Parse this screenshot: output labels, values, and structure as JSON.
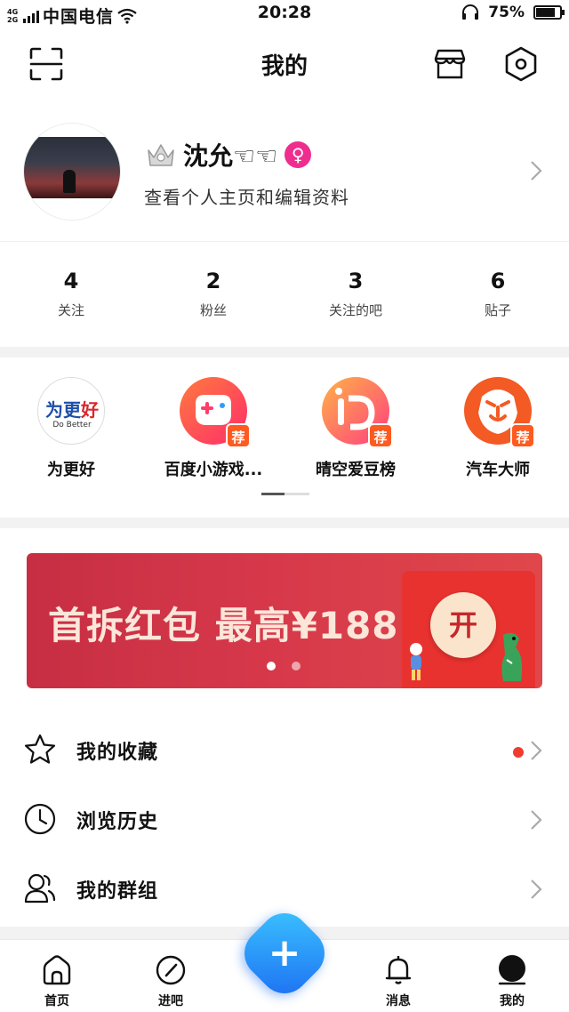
{
  "status_bar": {
    "network": "4G\n2G",
    "carrier": "中国电信",
    "time": "20:28",
    "battery_text": "75%",
    "battery_level": 0.75
  },
  "nav": {
    "title": "我的",
    "icons": [
      "scan-icon",
      "store-icon",
      "settings-icon"
    ]
  },
  "profile": {
    "username": "沈允☜☜",
    "gender_symbol": "♀",
    "subtitle": "查看个人主页和编辑资料"
  },
  "stats": [
    {
      "value": "4",
      "label": "关注"
    },
    {
      "value": "2",
      "label": "粉丝"
    },
    {
      "value": "3",
      "label": "关注的吧"
    },
    {
      "value": "6",
      "label": "贴子"
    }
  ],
  "apps": [
    {
      "label": "为更好",
      "logo_text": "为更好",
      "logo_sub": "Do Better",
      "tag": ""
    },
    {
      "label": "百度小游戏...",
      "tag": "荐"
    },
    {
      "label": "晴空爱豆榜",
      "tag": "荐"
    },
    {
      "label": "汽车大师",
      "tag": "荐"
    }
  ],
  "banner": {
    "text": "首拆红包 最高¥188",
    "button": "开"
  },
  "menu": [
    {
      "label": "我的收藏",
      "icon": "star-icon"
    },
    {
      "label": "浏览历史",
      "icon": "clock-icon"
    },
    {
      "label": "我的群组",
      "icon": "group-icon"
    }
  ],
  "tabs": [
    {
      "label": "首页",
      "icon": "home-icon"
    },
    {
      "label": "进吧",
      "icon": "compass-icon"
    },
    {
      "label": "消息",
      "icon": "bell-icon"
    },
    {
      "label": "我的",
      "icon": "profile-icon"
    }
  ],
  "colors": {
    "accent_blue": "#1c6df2",
    "red_dot": "#f03c2e",
    "tag_orange": "#ff5a1f",
    "banner_red": "#d6384a"
  }
}
